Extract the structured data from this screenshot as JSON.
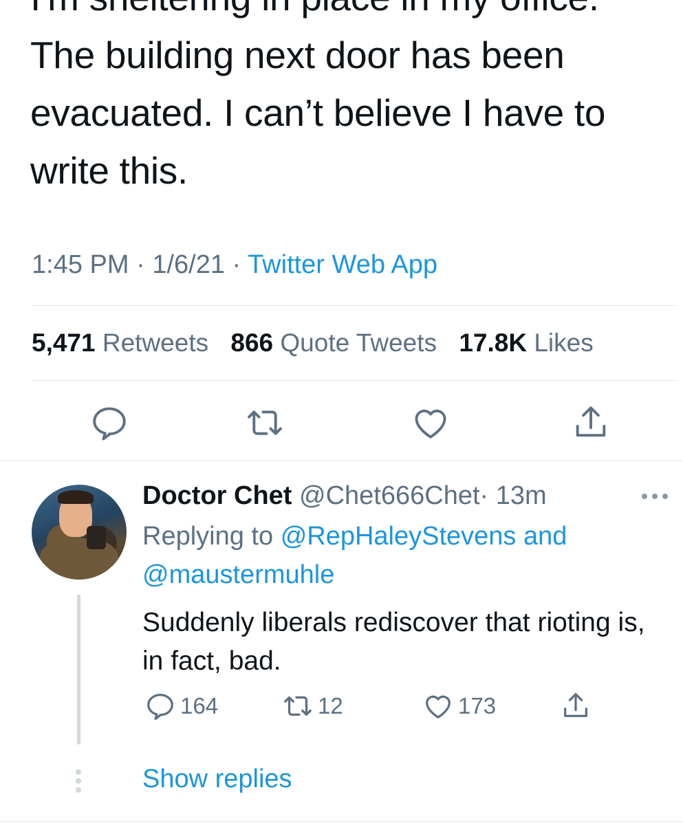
{
  "tweet": {
    "text_lines": [
      "I'm sheltering in place in my office.",
      "The building next door has been",
      "evacuated. I can’t believe I have to",
      "write this."
    ],
    "time": "1:45 PM",
    "sep": "·",
    "date": "1/6/21",
    "source": "Twitter Web App",
    "stats": {
      "retweets_count": "5,471",
      "retweets_label": "Retweets",
      "quotes_count": "866",
      "quotes_label": "Quote Tweets",
      "likes_count": "17.8K",
      "likes_label": "Likes"
    },
    "actions": [
      "reply-icon",
      "retweet-icon",
      "like-icon",
      "share-icon"
    ]
  },
  "reply": {
    "name": "Doctor Chet",
    "handle": "@Chet666Chet",
    "sep": "·",
    "time": "13m",
    "replying_prefix": "Replying to",
    "replying_to_1": "@RepHaleyStevens",
    "replying_and": "and",
    "replying_to_2": "@maustermuhle",
    "text": "Suddenly liberals rediscover that rioting is, in fact, bad.",
    "counts": {
      "replies": "164",
      "retweets": "12",
      "likes": "173"
    }
  },
  "show_replies": "Show replies",
  "colors": {
    "accent": "#1b95e0",
    "muted": "#5b7083",
    "text": "#0f1419",
    "divider": "#e1e6ea"
  }
}
